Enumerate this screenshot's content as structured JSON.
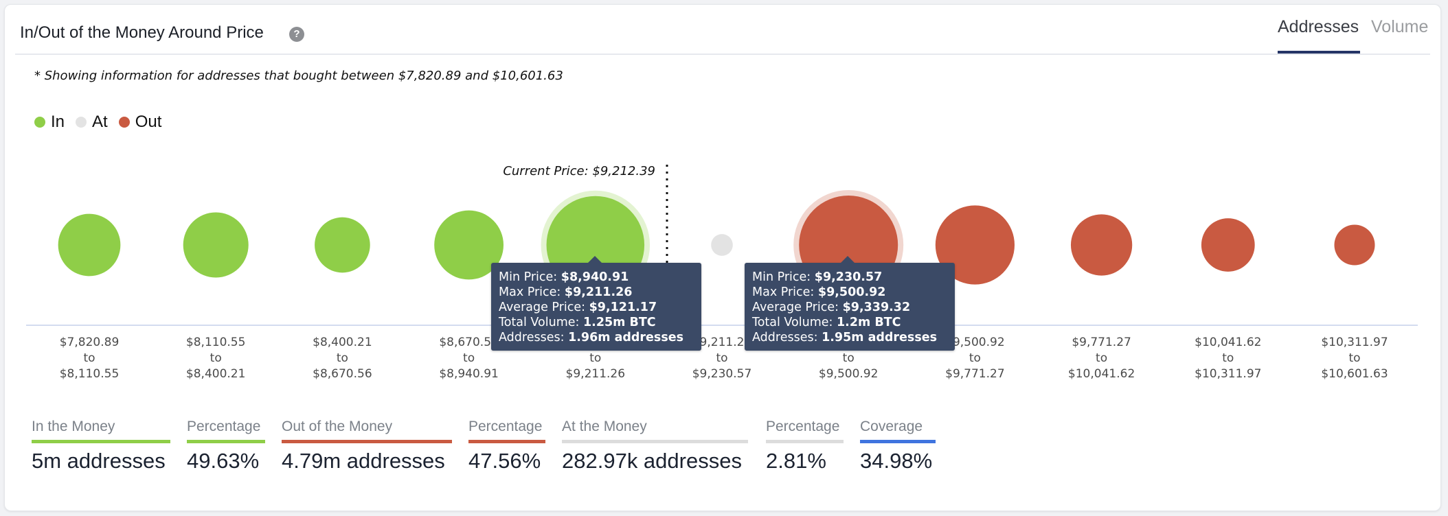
{
  "header": {
    "title": "In/Out of the Money Around Price",
    "help_icon": "question-circle-icon",
    "tabs": [
      {
        "label": "Addresses",
        "active": true
      },
      {
        "label": "Volume",
        "active": false
      }
    ]
  },
  "subtitle": "* Showing information for addresses that bought between $7,820.89 and $10,601.63",
  "legend": [
    {
      "label": "In",
      "color": "#8fce48"
    },
    {
      "label": "At",
      "color": "#e3e3e3"
    },
    {
      "label": "Out",
      "color": "#c95a41"
    }
  ],
  "colors": {
    "in": "#8fce48",
    "at": "#e3e3e3",
    "out": "#c95a41",
    "tooltip_bg": "#3b4a66",
    "coverage": "#3f74df",
    "active_tab": "#253466"
  },
  "chart_data": {
    "type": "scatter",
    "title": "In/Out of the Money Around Price",
    "xlabel": "",
    "ylabel": "",
    "current_price": {
      "label": "Current Price: $9,212.39",
      "value": 9212.39,
      "after_cluster_index": 4
    },
    "legend_position": "top-left",
    "grid": false,
    "clusters": [
      {
        "from": "$7,820.89",
        "to": "$8,110.55",
        "status": "in",
        "relative_size": 0.63
      },
      {
        "from": "$8,110.55",
        "to": "$8,400.21",
        "status": "in",
        "relative_size": 0.66
      },
      {
        "from": "$8,400.21",
        "to": "$8,670.56",
        "status": "in",
        "relative_size": 0.56
      },
      {
        "from": "$8,670.56",
        "to": "$8,940.91",
        "status": "in",
        "relative_size": 0.7
      },
      {
        "from": "$8,940.91",
        "to": "$9,211.26",
        "status": "in",
        "relative_size": 0.99,
        "highlighted": true
      },
      {
        "from": "$9,211.26",
        "to": "$9,230.57",
        "status": "at",
        "relative_size": 0.22
      },
      {
        "from": "$9,230.57",
        "to": "$9,500.92",
        "status": "out",
        "relative_size": 1.0,
        "highlighted": true
      },
      {
        "from": "$9,500.92",
        "to": "$9,771.27",
        "status": "out",
        "relative_size": 0.8
      },
      {
        "from": "$9,771.27",
        "to": "$10,041.62",
        "status": "out",
        "relative_size": 0.62
      },
      {
        "from": "$10,041.62",
        "to": "$10,311.97",
        "status": "out",
        "relative_size": 0.54
      },
      {
        "from": "$10,311.97",
        "to": "$10,601.63",
        "status": "out",
        "relative_size": 0.41
      }
    ],
    "range_connector": "to"
  },
  "tooltips": [
    {
      "rows": [
        {
          "label": "Min Price:",
          "value": "$8,940.91"
        },
        {
          "label": "Max Price:",
          "value": "$9,211.26"
        },
        {
          "label": "Average Price:",
          "value": "$9,121.17"
        },
        {
          "label": "Total Volume:",
          "value": "1.25m BTC"
        },
        {
          "label": "Addresses:",
          "value": "1.96m addresses"
        }
      ]
    },
    {
      "rows": [
        {
          "label": "Min Price:",
          "value": "$9,230.57"
        },
        {
          "label": "Max Price:",
          "value": "$9,500.92"
        },
        {
          "label": "Average Price:",
          "value": "$9,339.32"
        },
        {
          "label": "Total Volume:",
          "value": "1.2m BTC"
        },
        {
          "label": "Addresses:",
          "value": "1.95m addresses"
        }
      ]
    }
  ],
  "stats": [
    {
      "label": "In the Money",
      "value": "5m addresses",
      "color": "#8fce48"
    },
    {
      "label": "Percentage",
      "value": "49.63%",
      "color": "#8fce48"
    },
    {
      "label": "Out of the Money",
      "value": "4.79m addresses",
      "color": "#c95a41"
    },
    {
      "label": "Percentage",
      "value": "47.56%",
      "color": "#c95a41"
    },
    {
      "label": "At the Money",
      "value": "282.97k addresses",
      "color": "#dcdcdc"
    },
    {
      "label": "Percentage",
      "value": "2.81%",
      "color": "#dcdcdc"
    },
    {
      "label": "Coverage",
      "value": "34.98%",
      "color": "#3f74df"
    }
  ]
}
